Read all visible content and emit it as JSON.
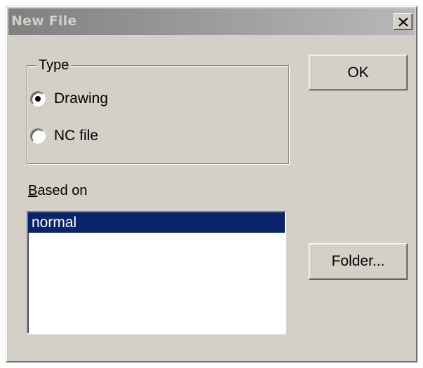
{
  "window": {
    "title": "New File",
    "close_label": "×"
  },
  "type_group": {
    "label": "Type",
    "options": [
      {
        "label": "Drawing",
        "selected": true
      },
      {
        "label": "NC file",
        "selected": false
      }
    ]
  },
  "based_on": {
    "label_mnemonic": "B",
    "label_rest": "ased on",
    "items": [
      {
        "label": "normal",
        "selected": true
      }
    ]
  },
  "buttons": {
    "ok_label": "OK",
    "folder_label": "Folder..."
  },
  "colors": {
    "dialog_bg": "#d4d0c8",
    "selection": "#0a246a",
    "title_gradient_start": "#808080",
    "title_gradient_end": "#b8b8b8"
  }
}
